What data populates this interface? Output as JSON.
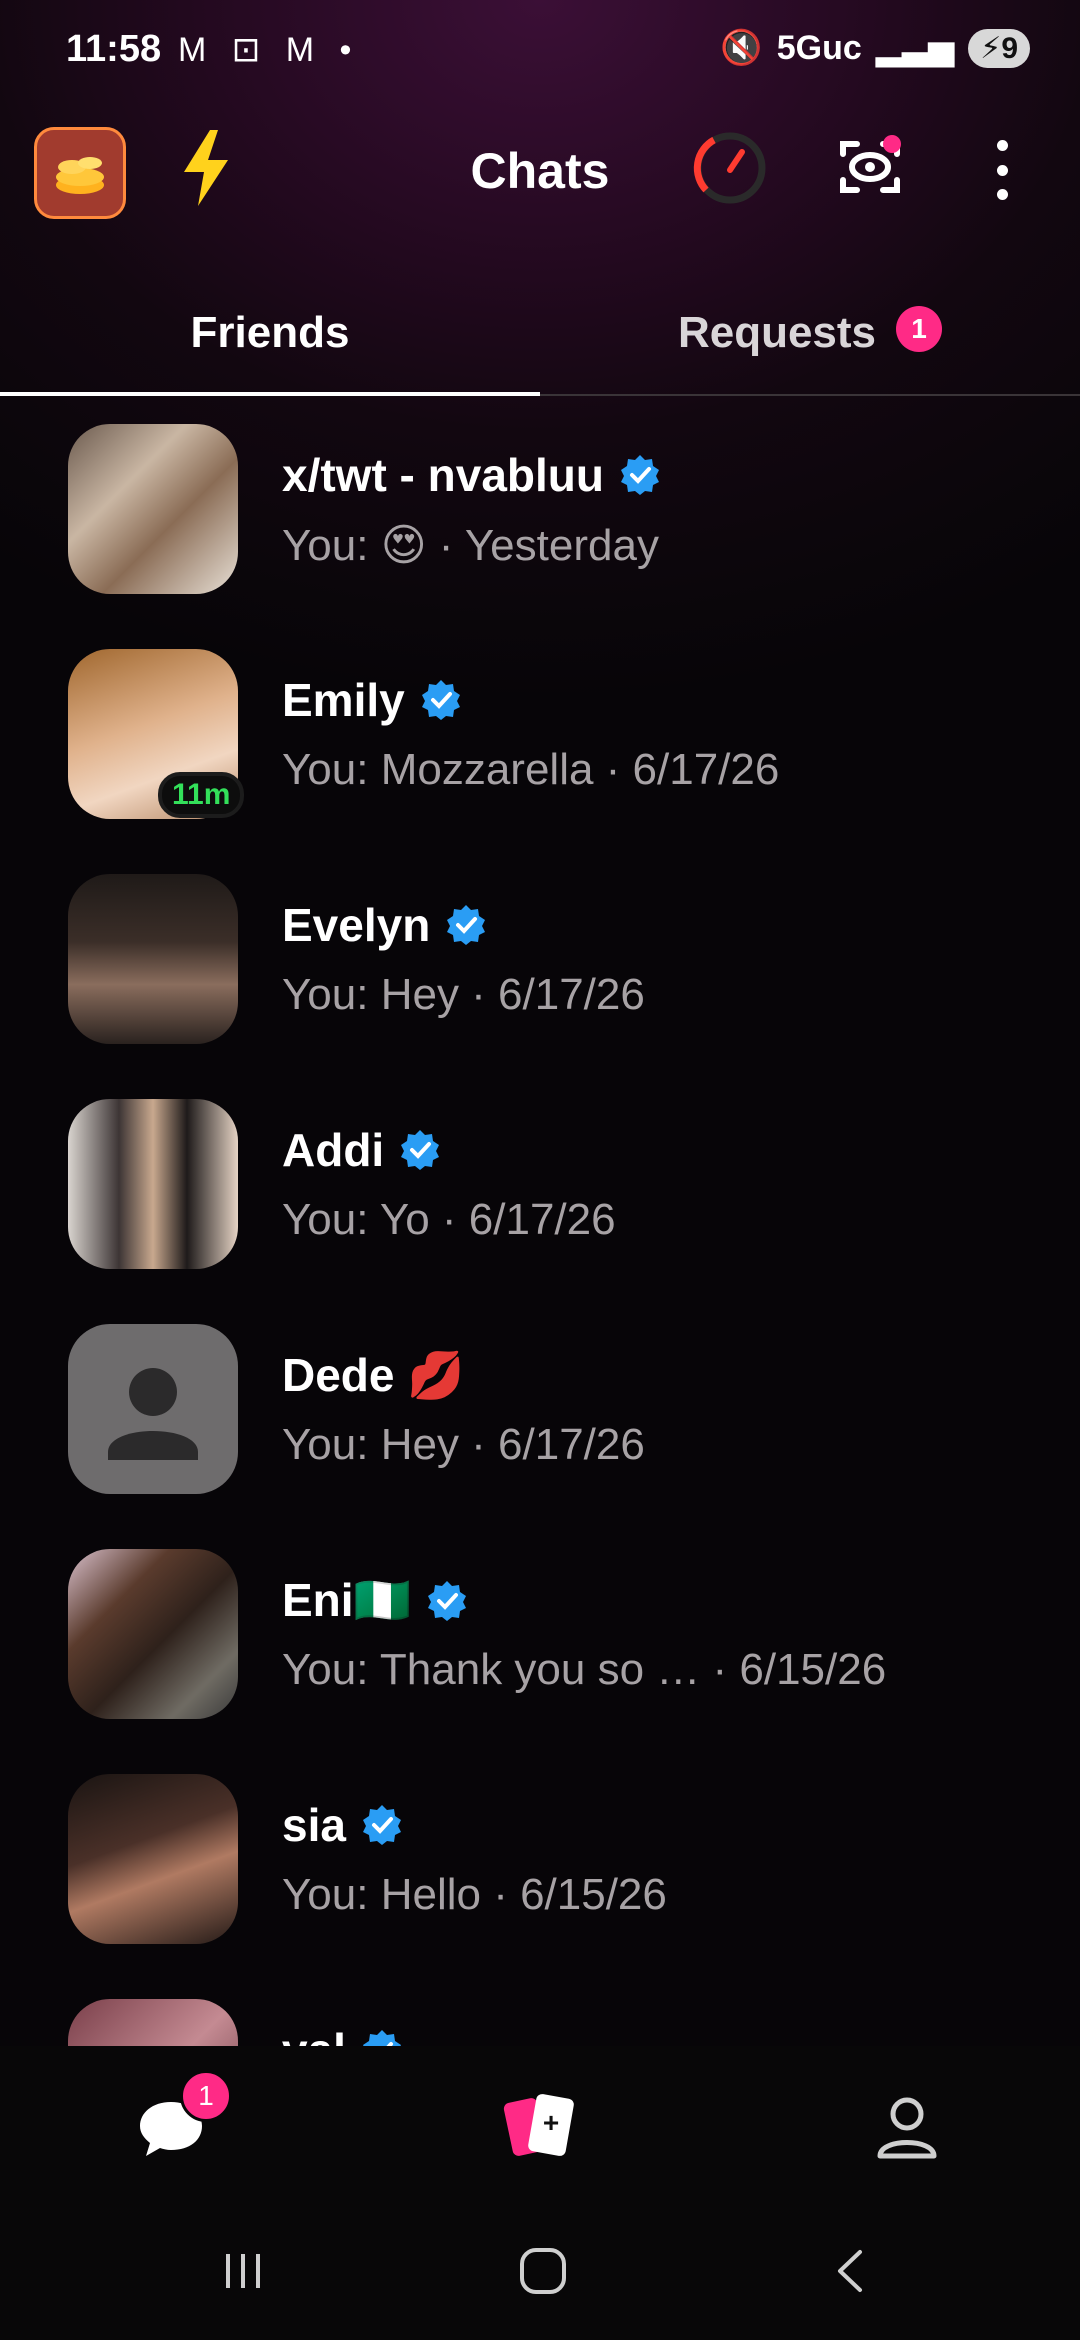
{
  "status_bar": {
    "time": "11:58",
    "left_icons": "M ⊡ M •",
    "network": "5Guc",
    "battery": "9"
  },
  "header": {
    "title": "Chats",
    "icons": [
      "coins-icon",
      "lightning-icon",
      "gauge-icon",
      "camera-icon",
      "more-vertical-icon"
    ]
  },
  "tabs": [
    {
      "label": "Friends",
      "active": true
    },
    {
      "label": "Requests",
      "badge": "1"
    }
  ],
  "chats": [
    {
      "name": "x/twt - nvabluu",
      "verified": true,
      "preview": "You: 😍 · Yesterday"
    },
    {
      "name": "Emily",
      "verified": true,
      "preview": "You: Mozzarella  · 6/17/26",
      "timer": "11m"
    },
    {
      "name": "Evelyn",
      "verified": true,
      "preview": "You: Hey · 6/17/26"
    },
    {
      "name": "Addi",
      "verified": true,
      "preview": "You: Yo · 6/17/26"
    },
    {
      "name": "Dede 💋",
      "verified": false,
      "preview": "You: Hey · 6/17/26"
    },
    {
      "name": "Eni🇳🇬",
      "verified": true,
      "preview": "You: Thank you so …  · 6/15/26"
    },
    {
      "name": " sia",
      "verified": true,
      "preview": "You: Hello · 6/15/26"
    },
    {
      "name": "val",
      "verified": true,
      "preview": ""
    }
  ],
  "bottom_nav": {
    "chat_badge": "1",
    "items": [
      "chat-icon",
      "cards-icon",
      "profile-icon"
    ]
  },
  "colors": {
    "accent_pink": "#ff2a86",
    "verified_blue": "#2a9df4",
    "timer_green": "#33e05a"
  }
}
